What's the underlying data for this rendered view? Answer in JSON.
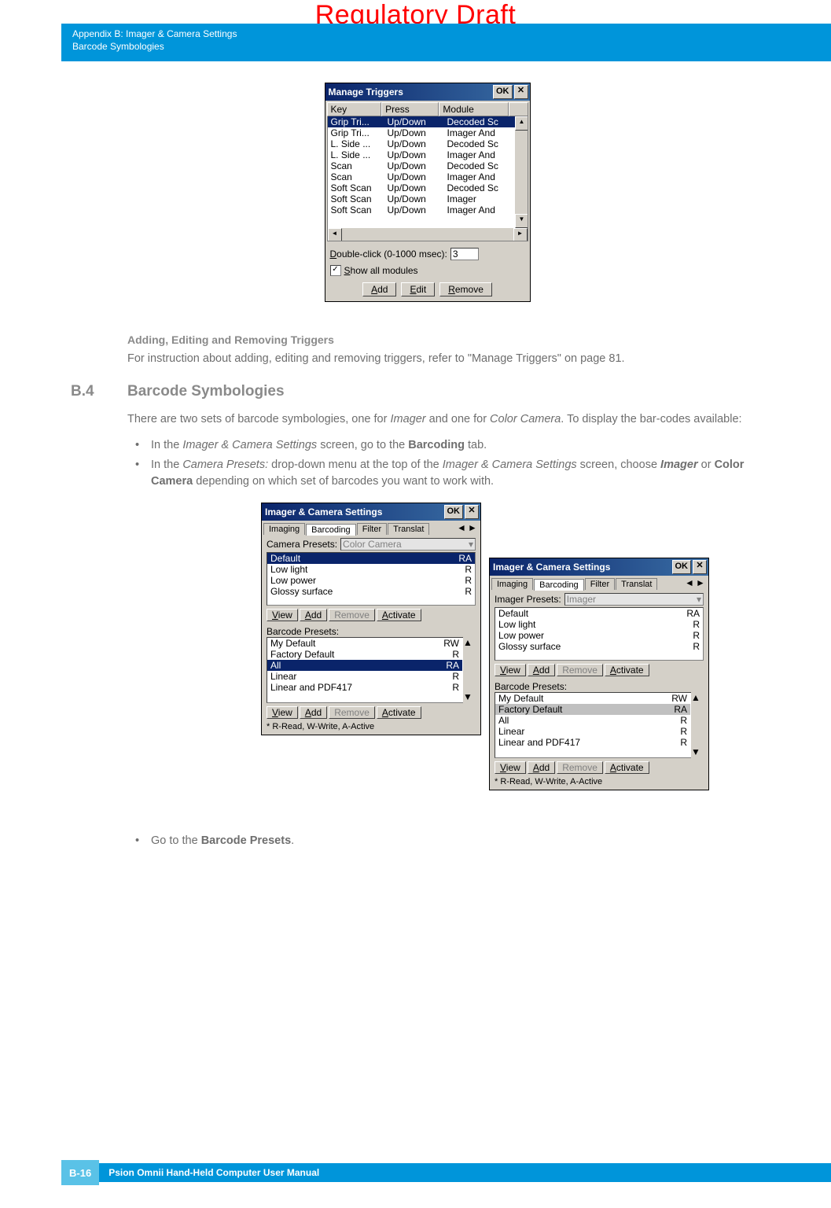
{
  "watermark": "Regulatory Draft",
  "header": {
    "line1": "Appendix B: Imager & Camera Settings",
    "line2": "Barcode Symbologies"
  },
  "dialog1": {
    "title": "Manage Triggers",
    "ok": "OK",
    "close": "✕",
    "columns": {
      "key": "Key",
      "press": "Press",
      "module": "Module"
    },
    "rows": [
      {
        "k": "Grip Tri...",
        "p": "Up/Down",
        "m": "Decoded Sc",
        "sel": true
      },
      {
        "k": "Grip Tri...",
        "p": "Up/Down",
        "m": "Imager And"
      },
      {
        "k": "L. Side ...",
        "p": "Up/Down",
        "m": "Decoded Sc"
      },
      {
        "k": "L. Side ...",
        "p": "Up/Down",
        "m": "Imager And"
      },
      {
        "k": "Scan",
        "p": "Up/Down",
        "m": "Decoded Sc"
      },
      {
        "k": "Scan",
        "p": "Up/Down",
        "m": "Imager And"
      },
      {
        "k": "Soft Scan",
        "p": "Up/Down",
        "m": "Decoded Sc"
      },
      {
        "k": "Soft Scan",
        "p": "Up/Down",
        "m": "Imager"
      },
      {
        "k": "Soft Scan",
        "p": "Up/Down",
        "m": "Imager And"
      }
    ],
    "dblclick_pre": "D",
    "dblclick_rest": "ouble-click (0-1000 msec):",
    "dblclick_val": "3",
    "showall_pre": "S",
    "showall_rest": "how all modules",
    "btn_add_pre": "A",
    "btn_add_rest": "dd",
    "btn_edit_pre": "E",
    "btn_edit_rest": "dit",
    "btn_remove_pre": "R",
    "btn_remove_rest": "emove"
  },
  "subheading": "Adding, Editing and Removing Triggers",
  "para1": "For instruction about adding, editing and removing triggers, refer to \"Manage Triggers\" on page 81.",
  "sec_num": "B.4",
  "sec_title": "Barcode Symbologies",
  "para2a": "There are two sets of barcode symbologies, one for ",
  "para2b": "Imager",
  "para2c": " and one for ",
  "para2d": "Color Camera",
  "para2e": ". To display the bar-codes available:",
  "bul1a": "In the ",
  "bul1b": "Imager & Camera Settings",
  "bul1c": " screen, go to the ",
  "bul1d": "Barcoding",
  "bul1e": " tab.",
  "bul2a": "In the ",
  "bul2b": "Camera Presets:",
  "bul2c": " drop-down menu at the top of the ",
  "bul2d": "Imager & Camera Settings",
  "bul2e": " screen, choose ",
  "bul2f": "Imager",
  "bul2g": " or ",
  "bul2h": "Color Camera",
  "bul2i": " depending on which set of barcodes you want to work with.",
  "dialog2": {
    "title": "Imager & Camera Settings",
    "tabs": {
      "imaging": "Imaging",
      "barcoding": "Barcoding",
      "filter": "Filter",
      "translat": "Translat"
    },
    "camera_label": "Camera Presets:",
    "camera_val": "Color Camera",
    "camera_list": [
      {
        "n": "Default",
        "f": "RA",
        "sel": true
      },
      {
        "n": "Low light",
        "f": "R"
      },
      {
        "n": "Low power",
        "f": "R"
      },
      {
        "n": "Glossy surface",
        "f": "R"
      }
    ],
    "barcode_label": "Barcode Presets:",
    "barcode_list": [
      {
        "n": "My Default",
        "f": "RW"
      },
      {
        "n": "Factory Default",
        "f": "R"
      },
      {
        "n": "All",
        "f": "RA",
        "sel": true
      },
      {
        "n": "Linear",
        "f": "R"
      },
      {
        "n": "Linear and PDF417",
        "f": "R"
      }
    ],
    "btns": {
      "view_pre": "V",
      "view": "iew",
      "add_pre": "A",
      "add": "dd",
      "remove_pre": "R",
      "remove": "emove",
      "activate_pre": "A",
      "activate": "ctivate"
    },
    "footnote": "* R-Read, W-Write, A-Active"
  },
  "dialog3": {
    "title": "Imager & Camera Settings",
    "imager_label": "Imager Presets:",
    "imager_val": "Imager",
    "imager_list": [
      {
        "n": "Default",
        "f": "RA"
      },
      {
        "n": "Low light",
        "f": "R"
      },
      {
        "n": "Low power",
        "f": "R"
      },
      {
        "n": "Glossy surface",
        "f": "R"
      }
    ],
    "barcode_list": [
      {
        "n": "My Default",
        "f": "RW"
      },
      {
        "n": "Factory Default",
        "f": "RA",
        "sel2": true
      },
      {
        "n": "All",
        "f": "R"
      },
      {
        "n": "Linear",
        "f": "R"
      },
      {
        "n": "Linear and PDF417",
        "f": "R"
      }
    ]
  },
  "bul3a": "Go to the ",
  "bul3b": "Barcode Presets",
  "bul3c": ".",
  "footer": {
    "pg": "B-16",
    "title": "Psion Omnii Hand-Held Computer User Manual"
  }
}
